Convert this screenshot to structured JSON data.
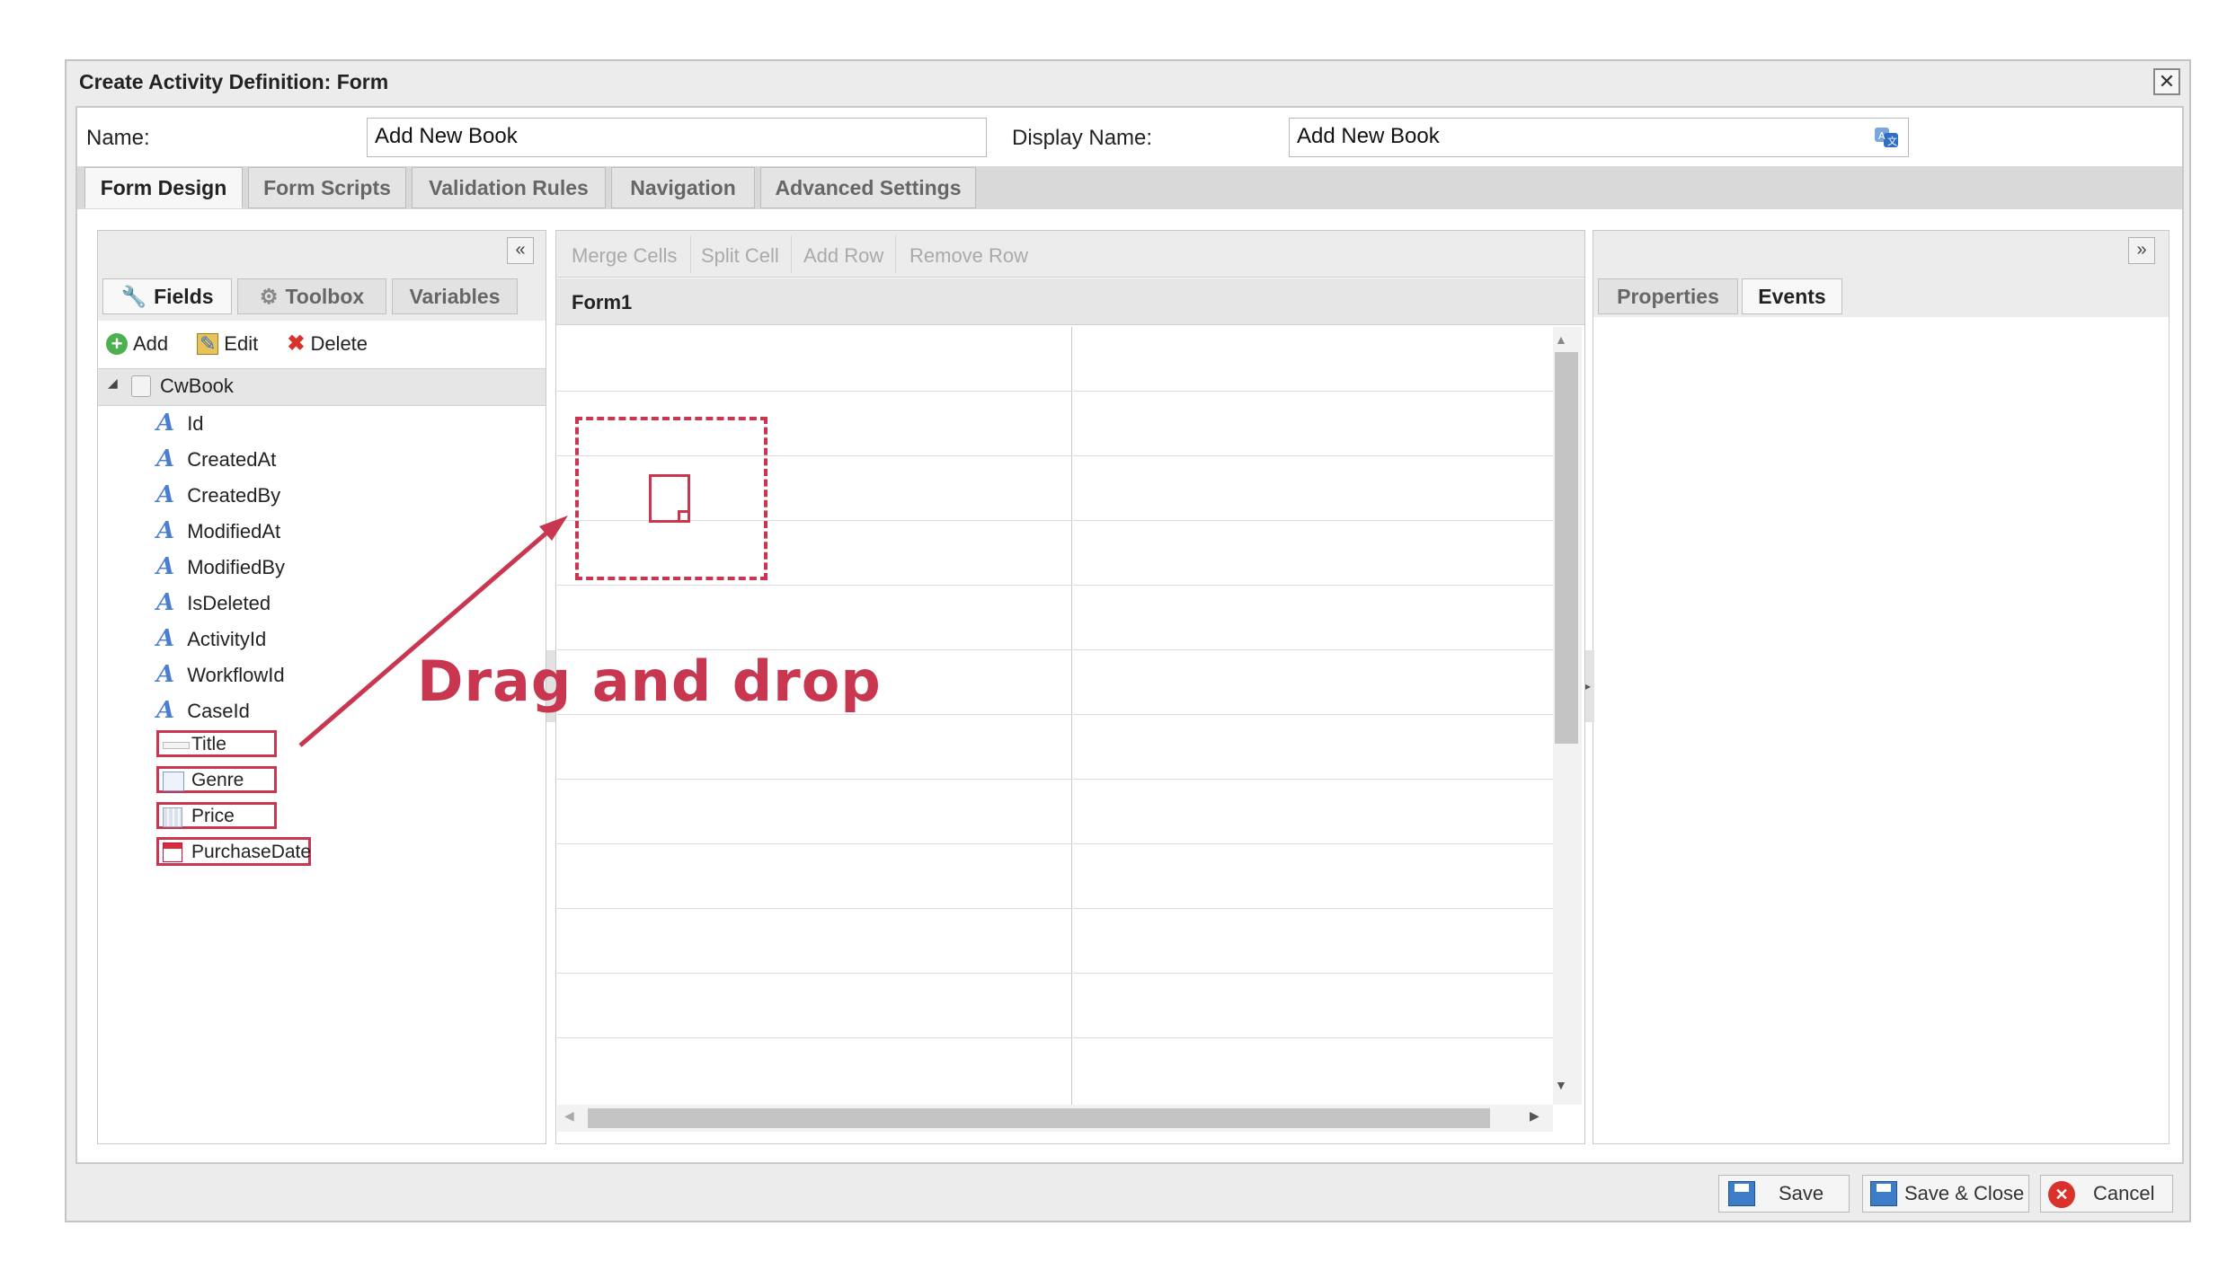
{
  "dialog": {
    "title": "Create Activity Definition: Form",
    "close_glyph": "✕"
  },
  "form": {
    "name_label": "Name:",
    "name_value": "Add New Book",
    "display_name_label": "Display Name:",
    "display_name_value": "Add New Book"
  },
  "main_tabs": [
    {
      "label": "Form Design",
      "active": true
    },
    {
      "label": "Form Scripts",
      "active": false
    },
    {
      "label": "Validation Rules",
      "active": false
    },
    {
      "label": "Navigation",
      "active": false
    },
    {
      "label": "Advanced Settings",
      "active": false
    }
  ],
  "left_panel": {
    "collapse_glyph": "«",
    "tabs": [
      {
        "label": "Fields",
        "active": true
      },
      {
        "label": "Toolbox",
        "active": false
      },
      {
        "label": "Variables",
        "active": false
      }
    ],
    "actions": {
      "add": "Add",
      "edit": "Edit",
      "delete": "Delete"
    },
    "tree_root": "CwBook",
    "fields": [
      "Id",
      "CreatedAt",
      "CreatedBy",
      "ModifiedAt",
      "ModifiedBy",
      "IsDeleted",
      "ActivityId",
      "WorkflowId",
      "CaseId"
    ],
    "custom_fields": [
      "Title",
      "Genre",
      "Price",
      "PurchaseDate"
    ]
  },
  "center_panel": {
    "toolbar": [
      "Merge Cells",
      "Split Cell",
      "Add Row",
      "Remove Row"
    ],
    "form_title": "Form1"
  },
  "right_panel": {
    "expand_glyph": "»",
    "tabs": [
      {
        "label": "Properties",
        "active": false
      },
      {
        "label": "Events",
        "active": true
      }
    ]
  },
  "annotation": {
    "text": "Drag and drop",
    "color": "#c8364f"
  },
  "footer": {
    "save": "Save",
    "save_close": "Save & Close",
    "cancel": "Cancel"
  },
  "colors": {
    "accent_red": "#c8364f",
    "field_icon_blue": "#4a7fd0",
    "panel_bg": "#ececec"
  }
}
